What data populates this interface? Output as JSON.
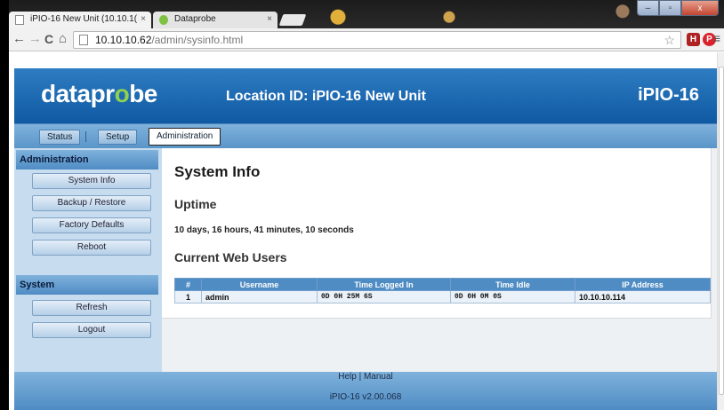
{
  "browser": {
    "tabs": [
      {
        "title": "iPIO-16 New Unit (10.10.1(",
        "close": "×"
      },
      {
        "title": "Dataprobe",
        "close": "×"
      }
    ],
    "nav": {
      "back": "←",
      "forward": "→",
      "reload": "C",
      "home": "⌂"
    },
    "url": {
      "host": "10.10.10.62",
      "path": "/admin/sysinfo.html"
    },
    "window_controls": {
      "minimize": "–",
      "maximize": "▫",
      "close": "x"
    },
    "extensions": [
      {
        "label": "H",
        "color": "#b02222"
      },
      {
        "label": "P",
        "color": "#d9232c"
      }
    ],
    "menu": "≡",
    "star": "☆"
  },
  "header": {
    "logo_part1": "datapr",
    "logo_accent": "o",
    "logo_part2": "be",
    "location": "Location ID: iPIO-16 New Unit",
    "model": "iPIO-16"
  },
  "nav": {
    "tabs": [
      {
        "label": "Status"
      },
      {
        "label": "Setup"
      },
      {
        "label": "Administration"
      }
    ]
  },
  "sidebar": {
    "admin_heading": "Administration",
    "admin_items": [
      {
        "label": "System Info"
      },
      {
        "label": "Backup / Restore"
      },
      {
        "label": "Factory Defaults"
      },
      {
        "label": "Reboot"
      }
    ],
    "system_heading": "System",
    "system_items": [
      {
        "label": "Refresh"
      },
      {
        "label": "Logout"
      }
    ]
  },
  "main": {
    "title": "System Info",
    "uptime_heading": "Uptime",
    "uptime_value": "10 days, 16 hours, 41 minutes, 10 seconds",
    "users_heading": "Current Web Users",
    "users_table": {
      "headers": [
        "#",
        "Username",
        "Time Logged In",
        "Time Idle",
        "IP Address"
      ],
      "rows": [
        [
          "1",
          "admin",
          "0D 0H 25M 6S",
          "0D 0H 0M 0S",
          "10.10.10.114"
        ]
      ]
    }
  },
  "footer": {
    "help": "Help",
    "separator": "|",
    "manual": "Manual",
    "version": "iPIO-16 v2.00.068"
  }
}
